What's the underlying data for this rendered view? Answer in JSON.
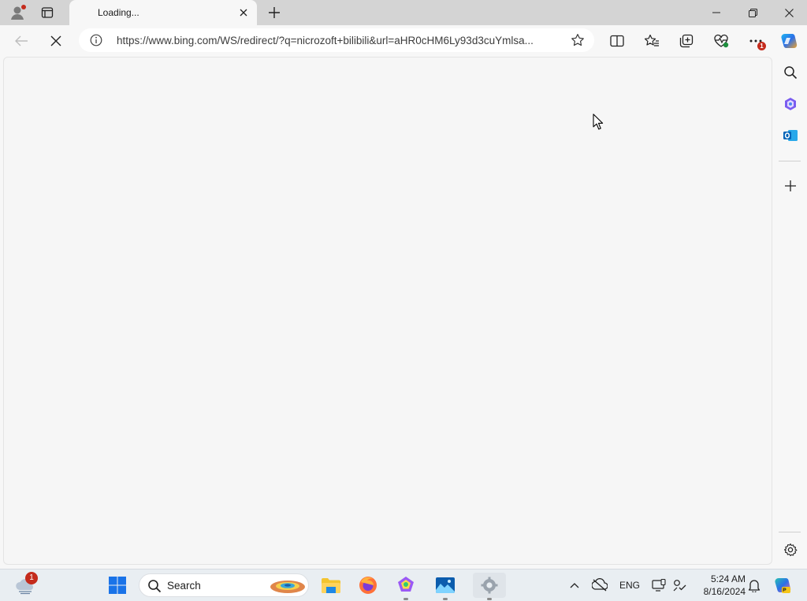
{
  "browser": {
    "tab": {
      "title": "Loading..."
    },
    "address": {
      "url": "https://www.bing.com/WS/redirect/?q=nicrozoft+bilibili&url=aHR0cHM6Ly93d3cuYmlsa..."
    },
    "toolbar_badge": "1"
  },
  "taskbar": {
    "weather_badge": "1",
    "search_label": "Search",
    "language": "ENG",
    "time": "5:24 AM",
    "date": "8/16/2024"
  },
  "colors": {
    "tabbar_bg": "#d4d4d4",
    "page_bg": "#f7f7f7",
    "accent_red": "#c42b1c",
    "windows_blue": "#1a73e8"
  },
  "icons": {
    "profile": "profile-icon",
    "tab_actions": "tab-actions-icon",
    "close_tab": "close-icon",
    "new_tab": "plus-icon",
    "back": "back-arrow-icon",
    "stop": "stop-loading-icon",
    "site_info": "info-icon",
    "favorite": "star-icon",
    "split": "split-screen-icon",
    "favorites": "favorites-icon",
    "collections": "collections-icon",
    "performance": "heart-pulse-icon",
    "more": "more-icon",
    "copilot": "copilot-icon"
  }
}
